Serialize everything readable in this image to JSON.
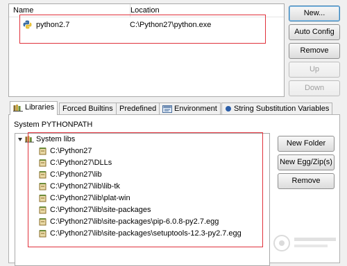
{
  "interpreters": {
    "headers": {
      "name": "Name",
      "location": "Location"
    },
    "rows": [
      {
        "name": "python2.7",
        "location": "C:\\Python27\\python.exe"
      }
    ]
  },
  "buttons": {
    "new": "New...",
    "auto_config": "Auto Config",
    "remove": "Remove",
    "up": "Up",
    "down": "Down"
  },
  "tabs": [
    {
      "label": "Libraries",
      "icon": "libraries-icon"
    },
    {
      "label": "Forced Builtins"
    },
    {
      "label": "Predefined"
    },
    {
      "label": "Environment",
      "icon": "environment-icon"
    },
    {
      "label": "String Substitution Variables",
      "icon": "bullet-icon"
    }
  ],
  "libraries": {
    "section_label": "System PYTHONPATH",
    "root": "System libs",
    "items": [
      "C:\\Python27",
      "C:\\Python27\\DLLs",
      "C:\\Python27\\lib",
      "C:\\Python27\\lib\\lib-tk",
      "C:\\Python27\\lib\\plat-win",
      "C:\\Python27\\lib\\site-packages",
      "C:\\Python27\\lib\\site-packages\\pip-6.0.8-py2.7.egg",
      "C:\\Python27\\lib\\site-packages\\setuptools-12.3-py2.7.egg"
    ],
    "buttons": {
      "new_folder": "New Folder",
      "new_egg": "New Egg/Zip(s)",
      "remove": "Remove"
    }
  },
  "colors": {
    "highlight": "#e0303a",
    "panel_bg": "#f0f0f0",
    "accent": "#3c7fb1"
  }
}
